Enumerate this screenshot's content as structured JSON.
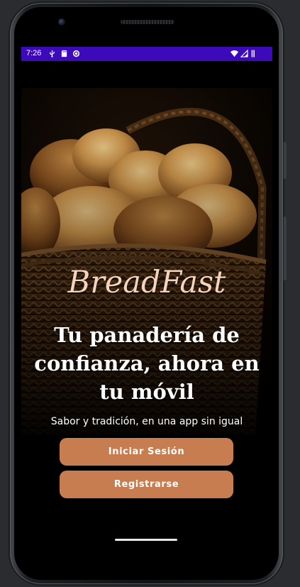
{
  "status_bar": {
    "time": "7:26",
    "icons": [
      "usb-debug-icon",
      "sd-card-icon",
      "sync-circle-icon",
      "wifi-icon",
      "signal-icon",
      "battery-icon"
    ]
  },
  "app": {
    "logo": "BreadFast",
    "headline": "Tu panadería de confianza, ahora en tu móvil",
    "tagline": "Sabor y tradición, en una app sin igual",
    "login_button": "Iniciar Sesión",
    "register_button": "Registrarse"
  },
  "colors": {
    "status_bar": "#3c0ab8",
    "button": "#c87d50",
    "logo": "#f6d3bc",
    "background": "#000000"
  },
  "hero_image": "bread-basket-photo"
}
